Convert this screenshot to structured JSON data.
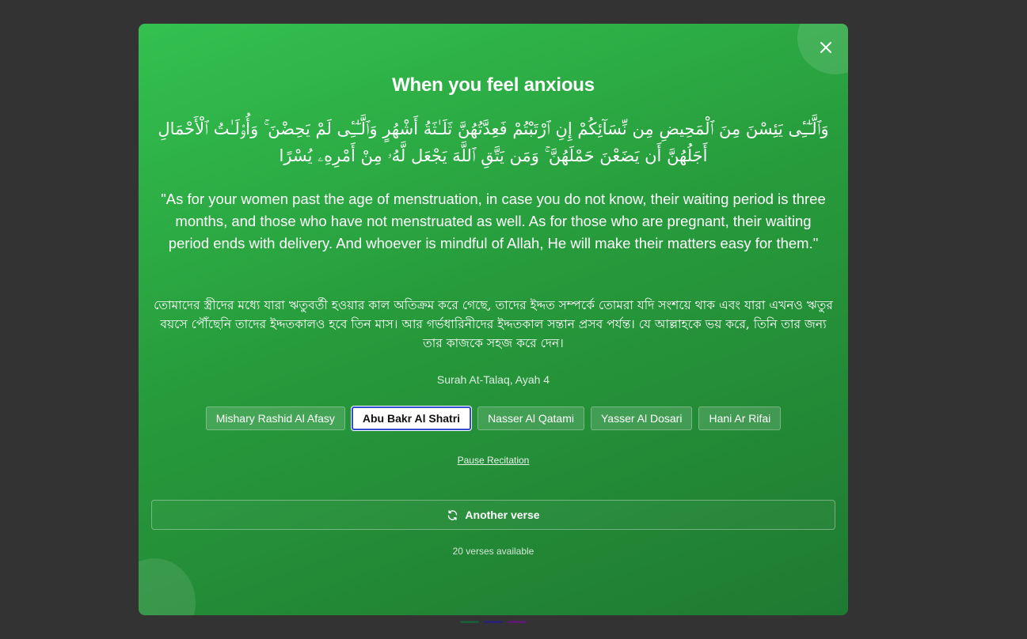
{
  "modal": {
    "title": "When you feel anxious",
    "arabic": "وَٱلَّـٰٓـِٔى يَئِسْنَ مِنَ ٱلْمَحِيضِ مِن نِّسَآئِكُمْ إِنِ ٱرْتَبْتُمْ فَعِدَّتُهُنَّ ثَلَـٰثَةُ أَشْهُرٍ وَٱلَّـٰٓـِٔى لَمْ يَحِضْنَ ۚ وَأُو۟لَـٰتُ ٱلْأَحْمَالِ أَجَلُهُنَّ أَن يَضَعْنَ حَمْلَهُنَّ ۚ وَمَن يَتَّقِ ٱللَّهَ يَجْعَل لَّهُۥ مِنْ أَمْرِهِۦ يُسْرًا",
    "english": "\"As for your women past the age of menstruation, in case you do not know, their waiting period is three months, and those who have not menstruated as well. As for those who are pregnant, their waiting period ends with delivery. And whoever is mindful of Allah, He will make their matters easy for them.\"",
    "bangla": "তোমাদের স্ত্রীদের মধ্যে যারা ঋতুবর্তী হওয়ার কাল অতিক্রম করে গেছে, তাদের ইদ্দত সম্পর্কে তোমরা যদি সংশয়ে থাক এবং যারা এখনও ঋতুর বয়সে পৌঁছেনি তাদের ইদ্দতকালও হবে তিন মাস। আর গর্ভধারিনীদের ইদ্দতকাল সন্তান প্রসব পর্যন্ত। যে আল্লাহকে ভয় করে, তিনি তার জন্য তার কাজকে সহজ করে দেন।",
    "reference": "Surah At-Talaq, Ayah 4",
    "reciters": [
      {
        "label": "Mishary Rashid Al Afasy",
        "active": false
      },
      {
        "label": "Abu Bakr Al Shatri",
        "active": true
      },
      {
        "label": "Nasser Al Qatami",
        "active": false
      },
      {
        "label": "Yasser Al Dosari",
        "active": false
      },
      {
        "label": "Hani Ar Rifai",
        "active": false
      }
    ],
    "pause_label": "Pause Recitation",
    "another_label": "Another verse",
    "another_icon": "refresh-icon",
    "count_text": "20 verses available",
    "close_icon": "close-icon"
  },
  "colors": {
    "backdrop": "#333333",
    "gradient_start": "#33c14f",
    "gradient_end": "#1f7a31",
    "active_border": "#2f4fd0",
    "indicator_dots": [
      "#1e5a3a",
      "#2a2470",
      "#5a1a6e"
    ]
  }
}
